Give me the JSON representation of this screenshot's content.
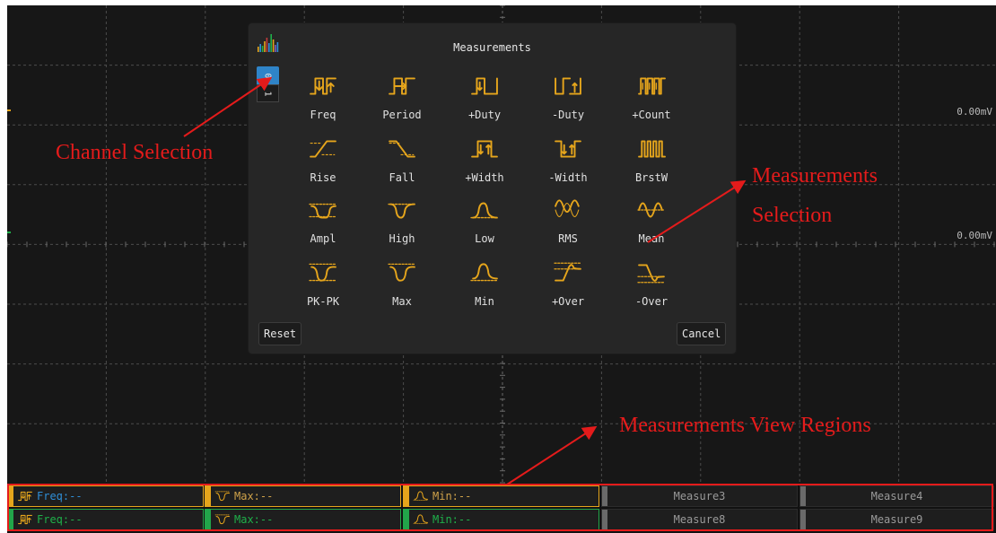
{
  "dialog": {
    "title": "Measurements",
    "reset_label": "Reset",
    "cancel_label": "Cancel",
    "channels": [
      "0",
      "1"
    ],
    "active_channel": "0",
    "items": [
      {
        "label": "Freq",
        "icon": "freq-icon"
      },
      {
        "label": "Period",
        "icon": "period-icon"
      },
      {
        "label": "+Duty",
        "icon": "pos-duty-icon"
      },
      {
        "label": "-Duty",
        "icon": "neg-duty-icon"
      },
      {
        "label": "+Count",
        "icon": "pos-count-icon"
      },
      {
        "label": "Rise",
        "icon": "rise-icon"
      },
      {
        "label": "Fall",
        "icon": "fall-icon"
      },
      {
        "label": "+Width",
        "icon": "pos-width-icon"
      },
      {
        "label": "-Width",
        "icon": "neg-width-icon"
      },
      {
        "label": "BrstW",
        "icon": "burst-width-icon"
      },
      {
        "label": "Ampl",
        "icon": "amplitude-icon"
      },
      {
        "label": "High",
        "icon": "high-icon"
      },
      {
        "label": "Low",
        "icon": "low-icon"
      },
      {
        "label": "RMS",
        "icon": "rms-icon"
      },
      {
        "label": "Mean",
        "icon": "mean-icon"
      },
      {
        "label": "PK-PK",
        "icon": "peak-to-peak-icon"
      },
      {
        "label": "Max",
        "icon": "max-icon"
      },
      {
        "label": "Min",
        "icon": "min-icon"
      },
      {
        "label": "+Over",
        "icon": "pos-overshoot-icon"
      },
      {
        "label": "-Over",
        "icon": "neg-overshoot-icon"
      }
    ]
  },
  "scope": {
    "voltage_labels": [
      "0.00mV",
      "0.00mV"
    ]
  },
  "measure_bar": {
    "rows": [
      [
        {
          "text": "Freq:--",
          "icon": "freq-icon",
          "channel": 0
        },
        {
          "text": "Max:--",
          "icon": "max-icon",
          "channel": 0
        },
        {
          "text": "Min:--",
          "icon": "min-icon",
          "channel": 0
        },
        {
          "text": "Measure3",
          "icon": "",
          "channel": -1
        },
        {
          "text": "Measure4",
          "icon": "",
          "channel": -1
        }
      ],
      [
        {
          "text": "Freq:--",
          "icon": "freq-icon",
          "channel": 1
        },
        {
          "text": "Max:--",
          "icon": "max-icon",
          "channel": 1
        },
        {
          "text": "Min:--",
          "icon": "min-icon",
          "channel": 1
        },
        {
          "text": "Measure8",
          "icon": "",
          "channel": -1
        },
        {
          "text": "Measure9",
          "icon": "",
          "channel": -1
        }
      ]
    ]
  },
  "annotations": {
    "channel_selection": "Channel Selection",
    "measurements_selection_line1": "Measurements",
    "measurements_selection_line2": "Selection",
    "view_regions": "Measurements View Regions"
  },
  "colors": {
    "icon": "#e5a51c",
    "ch0": "#2f8fd8",
    "ch1": "#1fb04a",
    "ch0_swatch": "#e5a51c",
    "ch1_swatch": "#22a54a",
    "cell_empty_swatch": "#6a6a6a",
    "annotation": "#e41b1b",
    "channel_active": "#2f84c8"
  }
}
